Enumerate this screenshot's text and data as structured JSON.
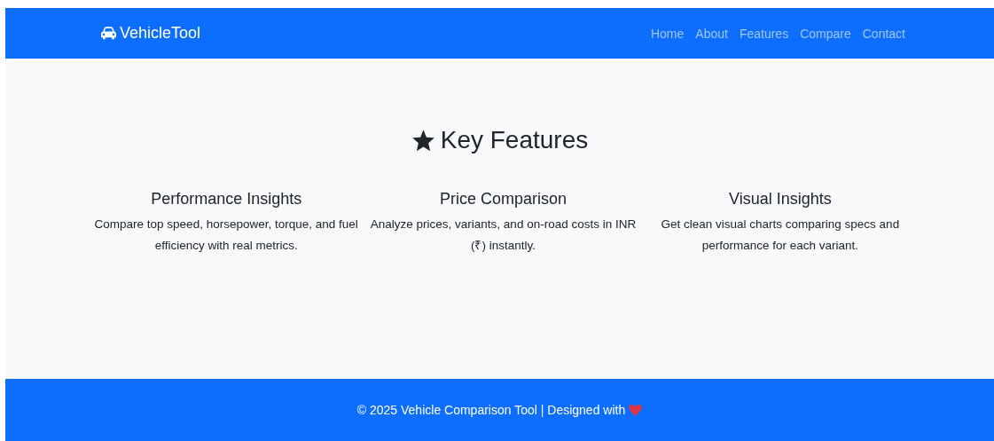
{
  "navbar": {
    "brand": "VehicleTool",
    "links": [
      {
        "label": "Home"
      },
      {
        "label": "About"
      },
      {
        "label": "Features"
      },
      {
        "label": "Compare"
      },
      {
        "label": "Contact"
      }
    ]
  },
  "features": {
    "title": "Key Features",
    "items": [
      {
        "heading": "Performance Insights",
        "text": "Compare top speed, horsepower, torque, and fuel efficiency with real metrics."
      },
      {
        "heading": "Price Comparison",
        "text": "Analyze prices, variants, and on-road costs in INR (₹) instantly."
      },
      {
        "heading": "Visual Insights",
        "text": "Get clean visual charts comparing specs and performance for each variant."
      }
    ]
  },
  "footer": {
    "text": "© 2025 Vehicle Comparison Tool | Designed with"
  }
}
